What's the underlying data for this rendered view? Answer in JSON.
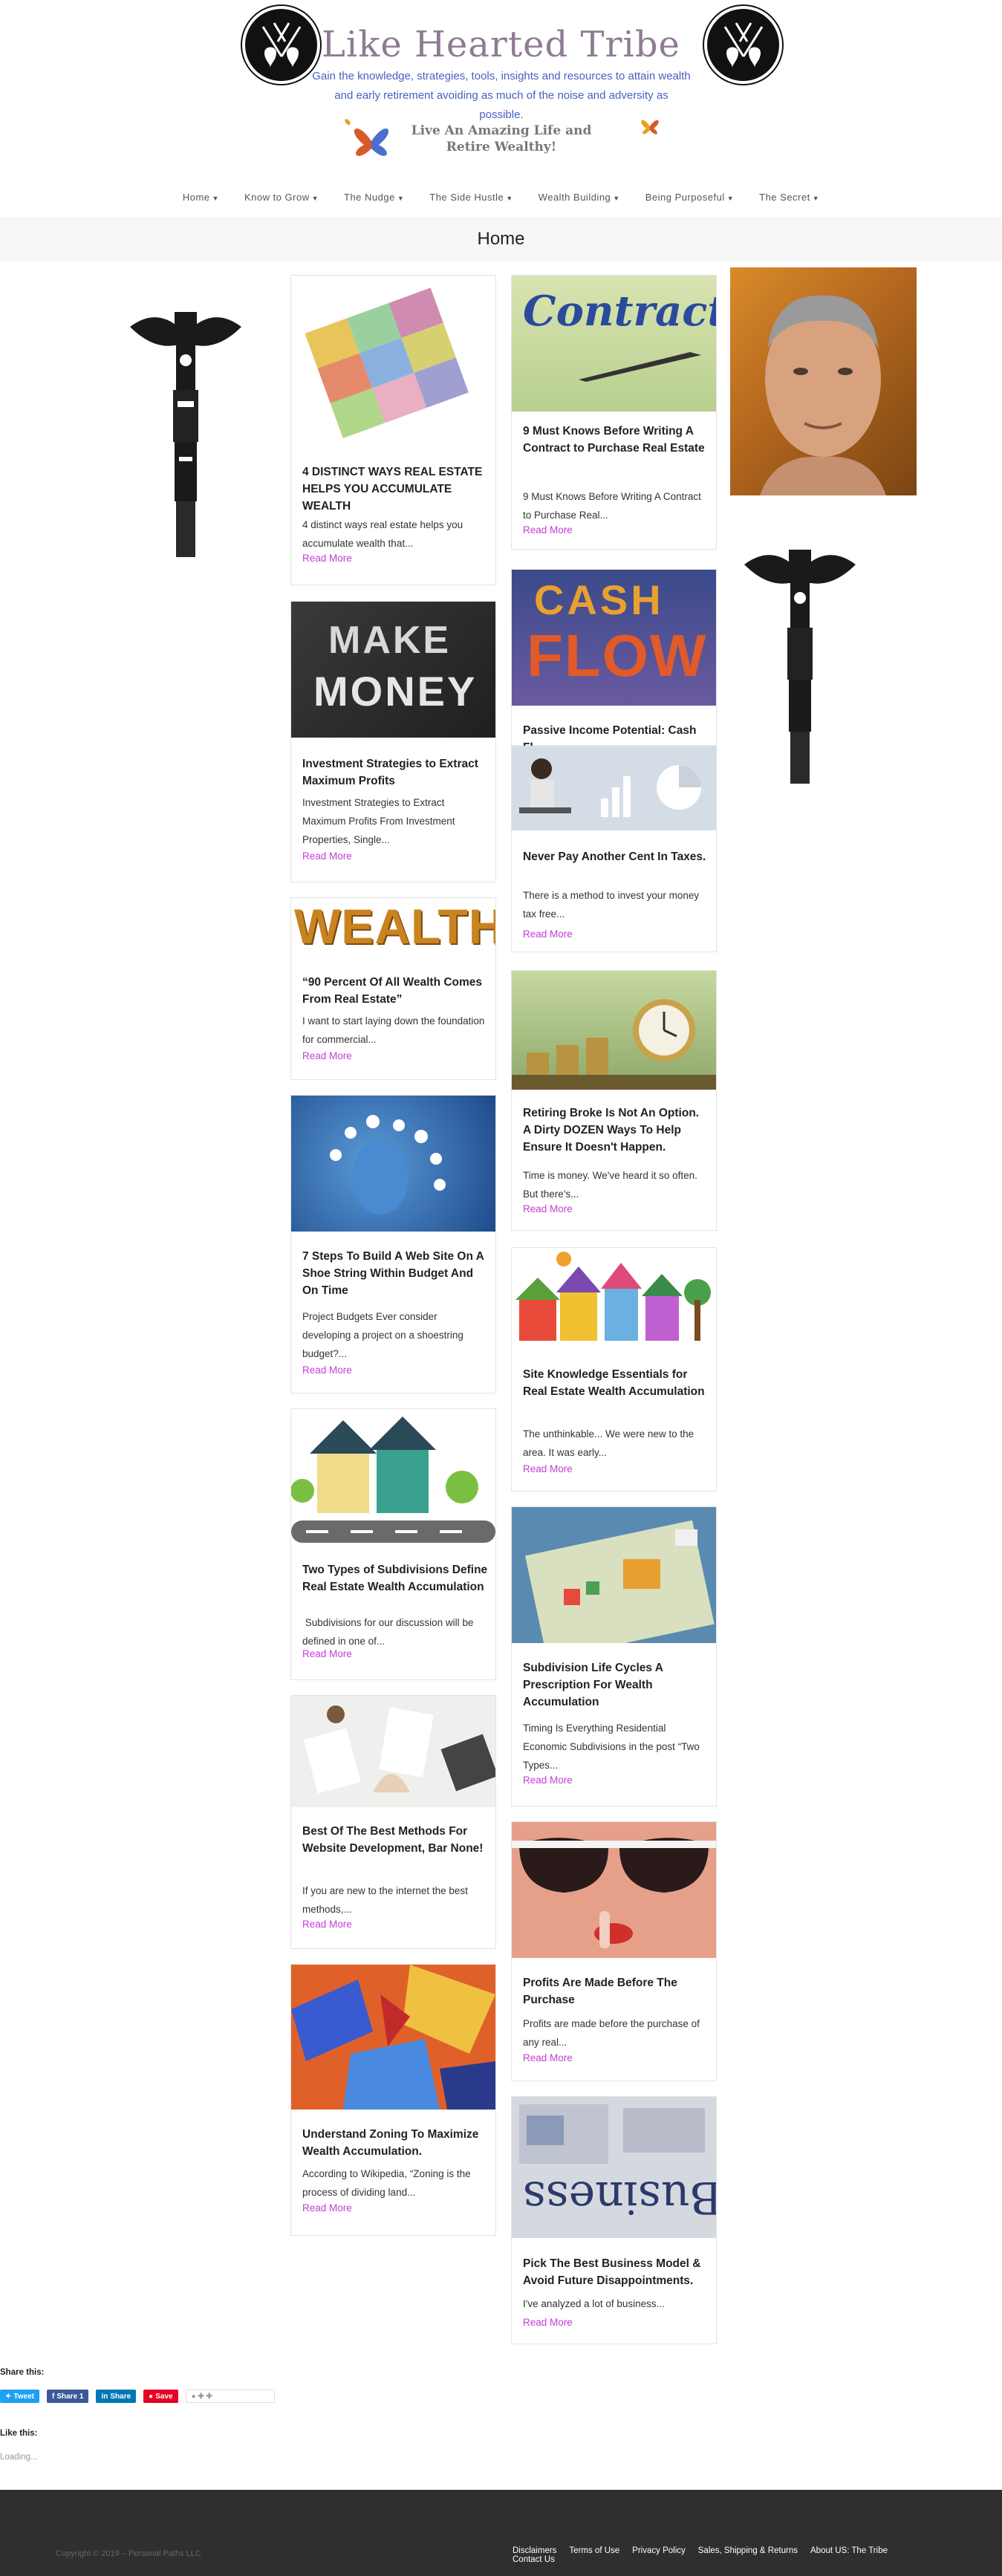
{
  "header": {
    "site_title": "Like Hearted Tribe",
    "site_description": "Gain the knowledge, strategies, tools, insights and resources to attain wealth and early retirement avoiding as much of the noise and adversity as possible.",
    "tagline": "Live An Amazing Life and Retire Wealthy!"
  },
  "nav": {
    "items": [
      {
        "label": "Home"
      },
      {
        "label": "Know to Grow"
      },
      {
        "label": "The Nudge"
      },
      {
        "label": "The Side Hustle"
      },
      {
        "label": "Wealth Building"
      },
      {
        "label": "Being Purposeful"
      },
      {
        "label": "The Secret"
      }
    ]
  },
  "page": {
    "title": "Home"
  },
  "posts": [
    {
      "title": "4 DISTINCT WAYS REAL ESTATE HELPS YOU ACCUMULATE WEALTH",
      "excerpt": "4 distinct ways real estate helps you accumulate wealth that...",
      "more": "Read More",
      "image_icon": "puzzle-money-image"
    },
    {
      "title": "9 Must Knows Before Writing A Contract to Purchase Real Estate",
      "excerpt": "9 Must Knows Before Writing A Contract to Purchase Real...",
      "more": "Read More",
      "image_icon": "contract-pen-image"
    },
    {
      "title": "Passive Income Potential: Cash Fl...",
      "excerpt": "",
      "more": "",
      "image_icon": "cash-flow-image"
    },
    {
      "title": "Investment Strategies to Extract Maximum Profits",
      "excerpt": "Investment Strategies to Extract Maximum Profits From Investment Properties, Single...",
      "more": "Read More",
      "image_icon": "make-money-chalkboard-image"
    },
    {
      "title": "Never Pay Another Cent In Taxes.",
      "excerpt": "There is a method to invest your money tax free...",
      "more": "Read More",
      "image_icon": "laptop-charts-image"
    },
    {
      "title": "“90 Percent Of All Wealth Comes From Real Estate”",
      "excerpt": "I want to start laying down the foundation for commercial...",
      "more": "Read More",
      "image_icon": "wealth-word-image"
    },
    {
      "title": "Retiring Broke Is Not An Option. A Dirty DOZEN Ways To Help Ensure It Doesn't Happen.",
      "excerpt": "Time is money. We've heard it so often. But there's...",
      "more": "Read More",
      "image_icon": "clock-coins-image"
    },
    {
      "title": "7 Steps To Build A Web Site On A Shoe String Within Budget And On Time",
      "excerpt": "Project Budgets Ever consider developing a project on a shoestring budget?...",
      "more": "Read More",
      "image_icon": "web-icons-face-image"
    },
    {
      "title": "Site Knowledge Essentials for Real Estate Wealth Accumulation",
      "excerpt": "The unthinkable... We were new to the area. It was early...",
      "more": "Read More",
      "image_icon": "cartoon-houses-image"
    },
    {
      "title": "Two Types of Subdivisions Define Real Estate Wealth Accumulation",
      "excerpt": " Subdivisions for our discussion will be defined in one of...",
      "more": "Read More",
      "image_icon": "two-houses-image"
    },
    {
      "title": "Subdivision Life Cycles A Prescription For Wealth Accumulation",
      "excerpt": "Timing Is Everything Residential Economic Subdivisions in the post “Two Types...",
      "more": "Read More",
      "image_icon": "monopoly-board-image"
    },
    {
      "title": "Best Of The Best Methods For Website Development, Bar None!",
      "excerpt": "If you are new to the internet the best methods,...",
      "more": "Read More",
      "image_icon": "desk-laptop-image"
    },
    {
      "title": "Profits Are Made Before The Purchase",
      "excerpt": "Profits are made before the purchase of any real...",
      "more": "Read More",
      "image_icon": "sunglasses-woman-image"
    },
    {
      "title": "Understand Zoning To Maximize Wealth Accumulation.",
      "excerpt": "According to Wikipedia, “Zoning is the process of dividing land...",
      "more": "Read More",
      "image_icon": "abstract-paint-image"
    },
    {
      "title": "Pick The Best Business Model & Avoid Future Disappointments.",
      "excerpt": "I've analyzed a lot of business...",
      "more": "Read More",
      "image_icon": "business-newspaper-image"
    }
  ],
  "images": {
    "contract_word": "Contract.",
    "make_money_1": "MAKE",
    "make_money_2": "MONEY",
    "wealth_word": "WEALTH",
    "cash_word": "CASH",
    "flow_word": "FLOW",
    "business_word": "Business"
  },
  "share": {
    "label": "Share this:",
    "tweet": "Tweet",
    "facebook": "Share 1",
    "linkedin": "Share",
    "pinterest": "Save"
  },
  "likes": {
    "label": "Like this:",
    "loading": "Loading..."
  },
  "footer": {
    "copyright": "Copyright © 2019 – Personal Paths LLC",
    "links": [
      "Disclaimers",
      "Terms of Use",
      "Privacy Policy",
      "Sales, Shipping & Returns",
      "About US: The Tribe",
      "Contact Us"
    ]
  },
  "colors": {
    "title": "#8e7b93",
    "description": "#4a5ec2",
    "read_more": "#c33dd6",
    "footer_bg": "#2f2f2f",
    "tweet": "#1da1f2",
    "facebook": "#3b5998",
    "linkedin": "#0077b5",
    "pinterest": "#e60023"
  }
}
